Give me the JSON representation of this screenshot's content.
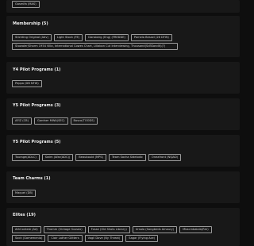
{
  "top_tag": "Gasmifa (MAS)",
  "sections": [
    {
      "title": "Membership (5)",
      "tags": [
        "Stichting Original (Adv)",
        "Light Stock (FE)",
        "Dansberg (Eng) (FREDDE)",
        "Pamela Bessel (26 DFW)",
        "Stowaler/Sharm 1954 Villa, International Cowes Chart, Lillabon Cut Interviewing, Thousand(ScBSandlt)(?)"
      ]
    },
    {
      "title": "Y4 Pilot Programs (1)",
      "tags": [
        "Peppa (DB NFW)"
      ]
    },
    {
      "title": "Y5 Pilot Programs (3)",
      "tags": [
        "AFIZ (CB)",
        "Gardner MWA(SEC)",
        "Bosco(TOODS)"
      ]
    },
    {
      "title": "Y5 Pilot Programs (5)",
      "tags": [
        "Tourage(ADLC)",
        "Swim (Afar(ADC))",
        "Beaubould (MPS)",
        "Team Sacha Sidelodic",
        "Oneafront (NSJAD)"
      ]
    },
    {
      "title": "Team Charms (1)",
      "tags": [
        "Maquel (DB)"
      ]
    },
    {
      "title": "Elites (19)",
      "tags": [
        "AthContest (Ad)",
        "Thomm (Vintage Sussex)",
        "Fosse (Old Shots Library)",
        "Ursala (Songbirds Amaury)",
        "Mkacmbalala(Rm)",
        "Sock (Gamemenia)",
        "Clair Lather Glitters",
        "Vogil Dove (Ny Threat)",
        "Sagar (Flying Ace)"
      ]
    }
  ]
}
